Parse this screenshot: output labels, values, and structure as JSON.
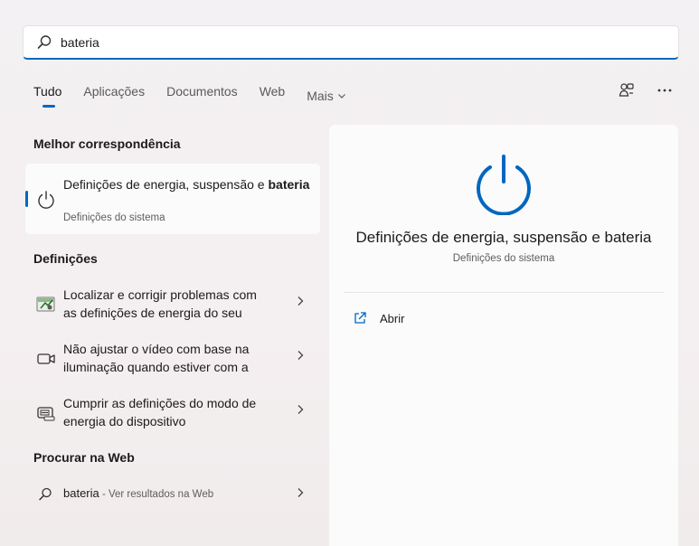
{
  "search": {
    "value": "bateria",
    "icon": "search-icon"
  },
  "tabs": [
    {
      "label": "Tudo",
      "active": true
    },
    {
      "label": "Aplicações"
    },
    {
      "label": "Documentos"
    },
    {
      "label": "Web"
    },
    {
      "label": "Mais"
    }
  ],
  "toolbar": {
    "icons": [
      "share-devices-icon",
      "more-options-icon"
    ]
  },
  "best_match": {
    "section_title": "Melhor correspondência",
    "title_prefix": "Definições de energia, suspensão e",
    "title_bold": "bateria",
    "subtitle": "Definições do sistema",
    "icon": "power-icon"
  },
  "settings": {
    "section_title": "Definições",
    "items": [
      {
        "line1": "Localizar e corrigir problemas com",
        "line2": "as definições de energia do seu",
        "icon": "troubleshoot-icon"
      },
      {
        "line1": "Não ajustar o vídeo com base na",
        "line2": "iluminação quando estiver com a",
        "icon": "video-icon"
      },
      {
        "line1": "Cumprir as definições do modo de",
        "line2": "energia do dispositivo",
        "icon": "battery-mode-icon"
      }
    ]
  },
  "web": {
    "section_title": "Procurar na Web",
    "query": "bateria",
    "suffix": " - Ver resultados na Web"
  },
  "preview": {
    "title": "Definições de energia, suspensão e bateria",
    "subtitle": "Definições do sistema",
    "action_label": "Abrir"
  },
  "colors": {
    "accent": "#0067c0"
  }
}
